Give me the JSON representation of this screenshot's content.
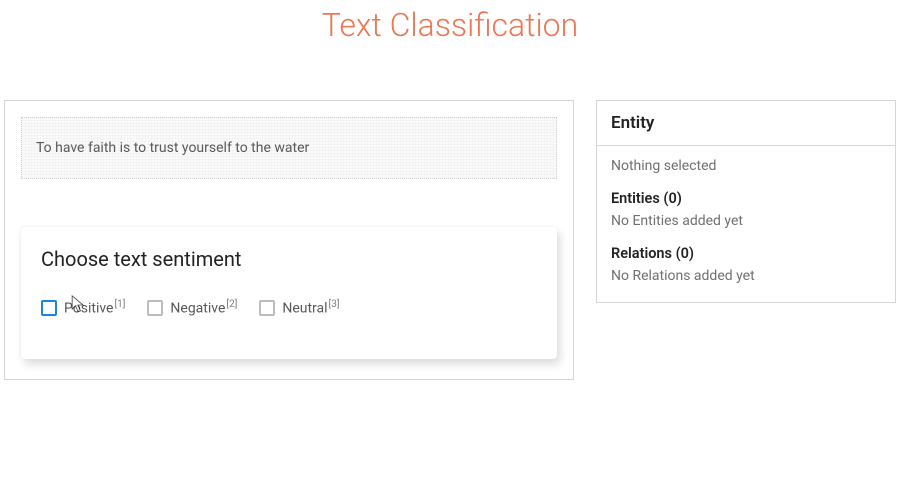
{
  "title": "Text Classification",
  "sample_text": "To have faith is to trust yourself to the water",
  "card": {
    "heading": "Choose text sentiment",
    "options": [
      {
        "label": "Positive",
        "shortcut": "1",
        "focused": true
      },
      {
        "label": "Negative",
        "shortcut": "2",
        "focused": false
      },
      {
        "label": "Neutral",
        "shortcut": "3",
        "focused": false
      }
    ]
  },
  "side": {
    "title": "Entity",
    "nothing_selected": "Nothing selected",
    "entities_label": "Entities (0)",
    "entities_empty": "No Entities added yet",
    "relations_label": "Relations (0)",
    "relations_empty": "No Relations added yet"
  }
}
